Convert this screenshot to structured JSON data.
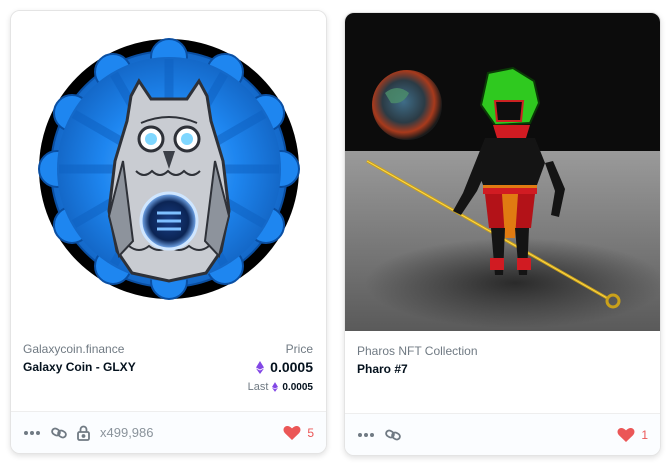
{
  "cards": [
    {
      "collection": "Galaxycoin.finance",
      "name": "Galaxy Coin - GLXY",
      "price_label": "Price",
      "price": "0.0005",
      "last_label": "Last",
      "last_price": "0.0005",
      "quantity": "x499,986",
      "likes": "5"
    },
    {
      "collection": "Pharos NFT Collection",
      "name": "Pharo #7",
      "likes": "1"
    }
  ],
  "colors": {
    "eth": "#8247e5",
    "heart": "#eb5757",
    "badge_blue": "#1d7fe6"
  },
  "icons": [
    "more-icon",
    "link-icon",
    "lock-icon",
    "heart-icon",
    "eth-icon"
  ]
}
